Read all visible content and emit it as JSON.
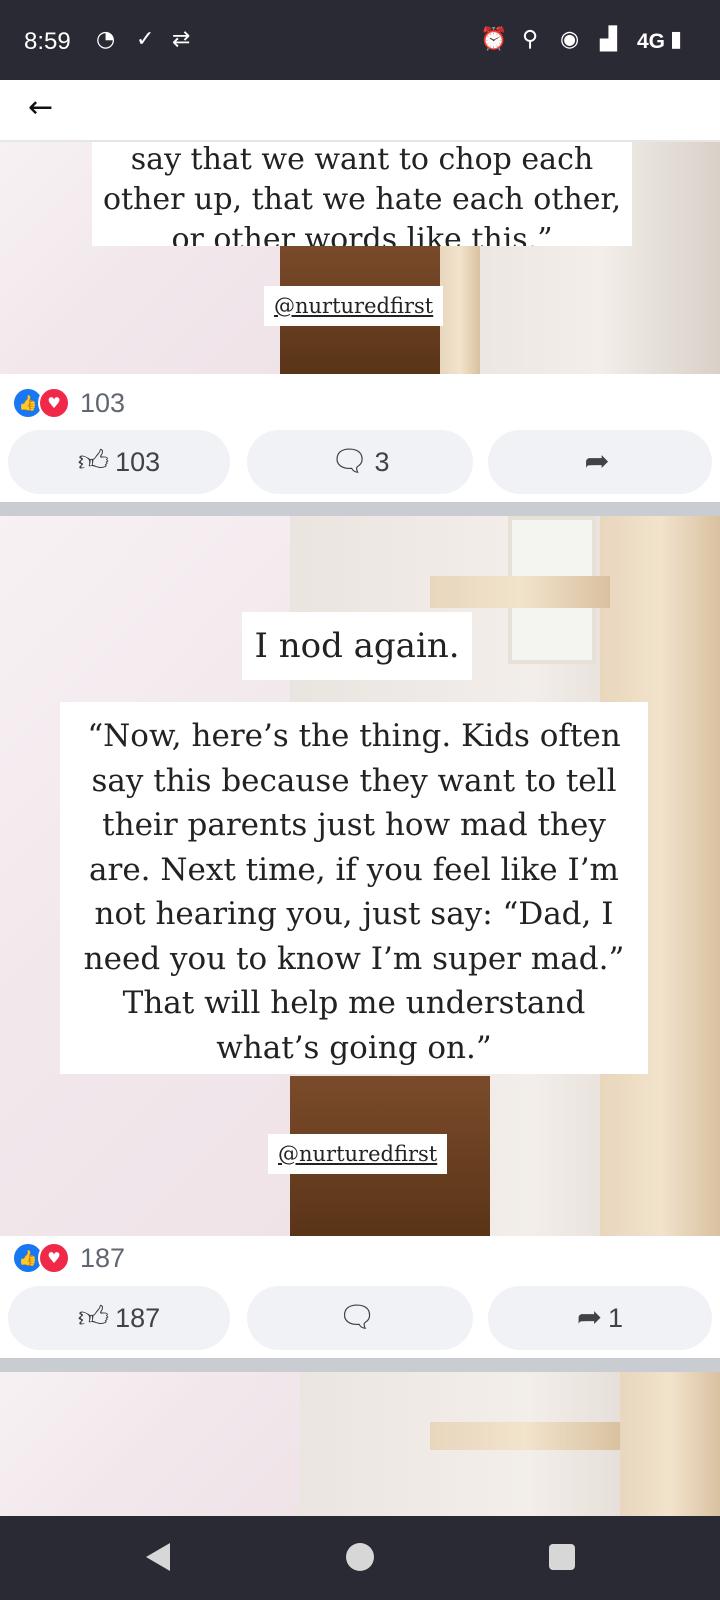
{
  "status_bar": {
    "time": "8:59",
    "left_icons": [
      "messenger-icon",
      "check-icon",
      "data-transfer-icon"
    ],
    "right_icons": [
      "alarm-icon",
      "location-icon",
      "hotspot-icon",
      "signal-icon",
      "battery-icon"
    ],
    "network": "4G"
  },
  "app_bar": {
    "back_icon": "back-arrow-icon"
  },
  "posts": [
    {
      "quote": "say that we want to chop each other up, that we hate each other, or other words like this.”",
      "handle": "@nurturedfirst",
      "reaction_count": "103",
      "like_count": "103",
      "comment_count": "3",
      "share_count": ""
    },
    {
      "caption": "I nod again.",
      "quote": "“Now, here’s the thing. Kids often say this because they want to tell their parents just how mad they are. Next time, if you feel like I’m not hearing you, just say: “Dad, I need you to know I’m super mad.” That will help me understand what’s going on.”",
      "handle": "@nurturedfirst",
      "reaction_count": "187",
      "like_count": "187",
      "comment_count": "",
      "share_count": "1"
    }
  ],
  "colors": {
    "status_bar": "#2a2a35",
    "like_blue": "#1877f2",
    "love_red": "#f02849",
    "action_button": "#f0f2f5",
    "divider": "#c9ccd1"
  }
}
